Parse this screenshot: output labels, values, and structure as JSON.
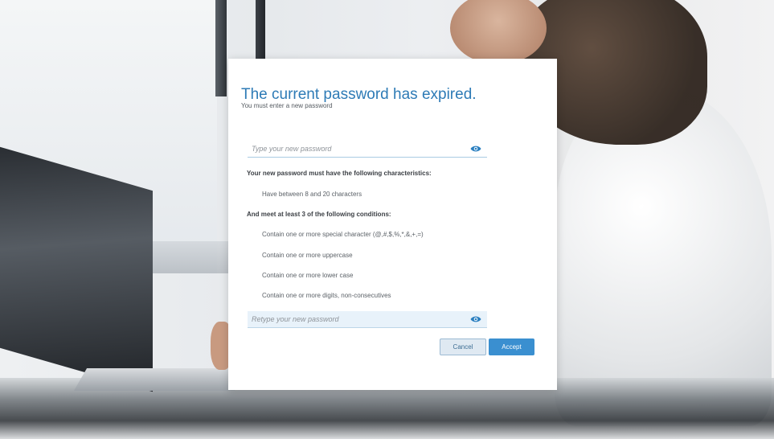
{
  "dialog": {
    "title": "The current password has expired.",
    "subtitle": "You must enter a new password",
    "new_password": {
      "placeholder": "Type your new password",
      "value": "",
      "icon": "eye-icon"
    },
    "requirements_heading": "Your new password must have the following characteristics:",
    "length_rule": "Have between 8 and 20 characters",
    "conditions_heading": "And meet at least 3 of the following conditions:",
    "conditions": [
      "Contain one or more special character (@,#,$,%,*,&,+,=)",
      "Contain one or more uppercase",
      "Contain one or more lower case",
      "Contain one or more digits, non-consecutives"
    ],
    "retype_password": {
      "placeholder": "Retype your new password",
      "value": "",
      "icon": "eye-icon"
    },
    "cancel_label": "Cancel",
    "accept_label": "Accept"
  },
  "colors": {
    "accent": "#2e7bb6",
    "button_primary": "#3a8fd0",
    "button_secondary": "#dfe9f2",
    "eye_icon": "#2a7fc0"
  }
}
